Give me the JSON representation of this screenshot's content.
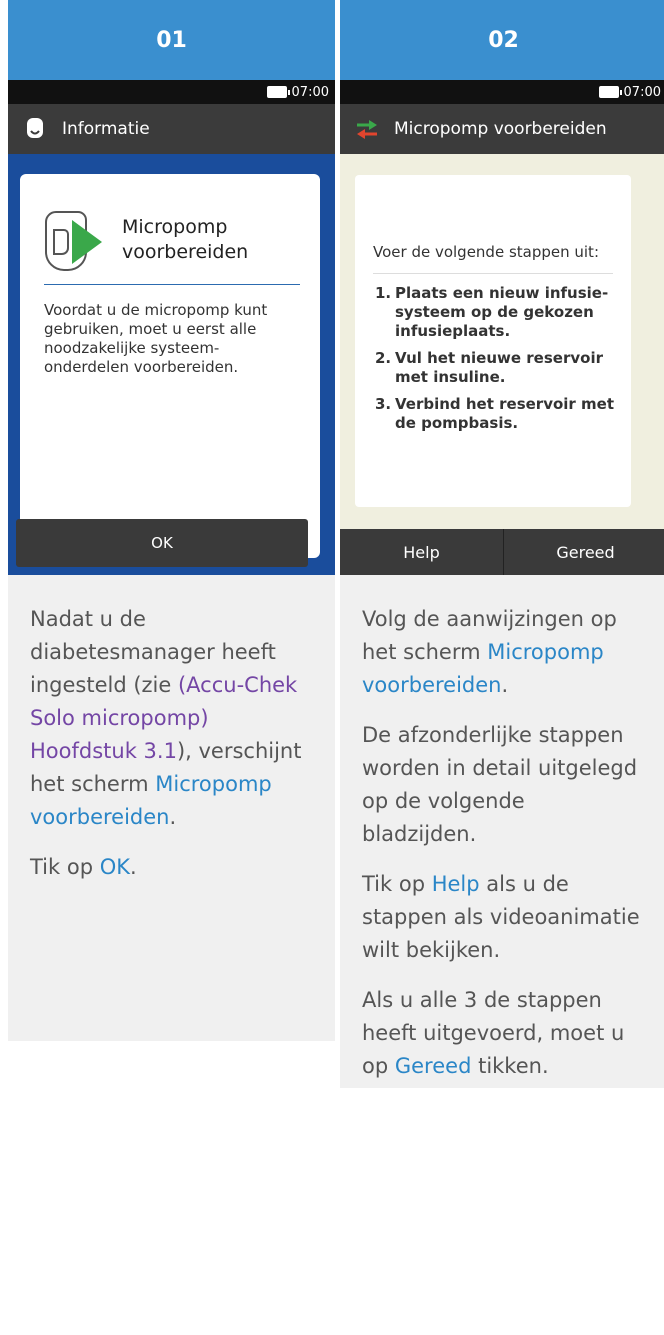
{
  "steps": [
    {
      "number": "01",
      "status_time": "07:00",
      "title": "Informatie",
      "dialog": {
        "title": "Micropomp voorbereiden",
        "body": "Voordat u de micropomp kunt gebruiken, moet u eerst alle noodzakelijke systeem-onderdelen voorbereiden.",
        "ok_label": "OK"
      },
      "text": {
        "p1_before": "Nadat u de diabetesmanager heeft ingesteld (zie ",
        "p1_link1": "(Accu-Chek Solo micropomp) Hoofdstuk 3.1",
        "p1_mid": "), verschijnt het scherm ",
        "p1_link2": "Micropomp voorbereiden",
        "p1_end": ".",
        "p2_before": "Tik op ",
        "p2_link": "OK",
        "p2_end": "."
      }
    },
    {
      "number": "02",
      "status_time": "07:00",
      "title": "Micropomp voorbereiden",
      "dialog": {
        "intro": "Voer de volgende stappen uit:",
        "items": [
          {
            "num": "1.",
            "text": "Plaats een nieuw infusie-systeem op de gekozen infusieplaats."
          },
          {
            "num": "2.",
            "text": "Vul het nieuwe reservoir met insuline."
          },
          {
            "num": "3.",
            "text": "Verbind het reservoir met de pompbasis."
          }
        ],
        "help_label": "Help",
        "done_label": "Gereed"
      },
      "text": {
        "p1_before": "Volg de aanwijzingen op het scherm ",
        "p1_link": "Micropomp voorbereiden",
        "p1_end": ".",
        "p2": "De afzonderlijke stappen worden in detail uitgelegd op de volgende bladzijden.",
        "p3_before": "Tik op ",
        "p3_link": "Help",
        "p3_end": " als u de stappen als videoanimatie wilt bekijken.",
        "p4_before": "Als u alle 3 de stappen heeft uitgevoerd, moet u op ",
        "p4_link": "Gereed",
        "p4_end": " tikken."
      }
    }
  ]
}
